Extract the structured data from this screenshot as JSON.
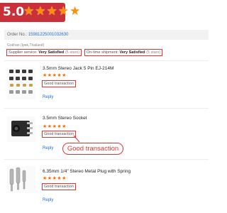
{
  "rating": {
    "score": "5.0",
    "star_count": 5,
    "banner_color": "#c9313a",
    "star_color": "#ff8f00"
  },
  "order": {
    "label": "Order No.:",
    "number": "15981225001032630"
  },
  "buyer_location": "Gokhan (Ipek,Thailand)",
  "service": [
    {
      "label": "Supplier service:",
      "value": "Very Satisfied",
      "count": "(5 stars)"
    },
    {
      "label": "On-time shipment:",
      "value": "Very Satisfied",
      "count": "(5 stars)"
    }
  ],
  "products": [
    {
      "title": "3.5mm Stereo Jack 5 Pin EJ-214M",
      "stars": 5,
      "review": "Good transaction",
      "reply": "Reply",
      "image": "audio-jack-components"
    },
    {
      "title": "3.5mm Stereo Socket",
      "stars": 5,
      "review": "Good transaction",
      "reply": "Reply",
      "image": "stereo-socket"
    },
    {
      "title": "6.35mm 1/4\" Stereo Metal Plug with Spring",
      "stars": 5,
      "review": "Good transaction",
      "reply": "Reply",
      "image": "metal-plugs"
    }
  ],
  "callout": {
    "text": "Good transaction",
    "color": "#e3342f"
  },
  "colors": {
    "link": "#1f6fd1",
    "highlight": "#e3342f",
    "stars": "#ff6a00"
  }
}
